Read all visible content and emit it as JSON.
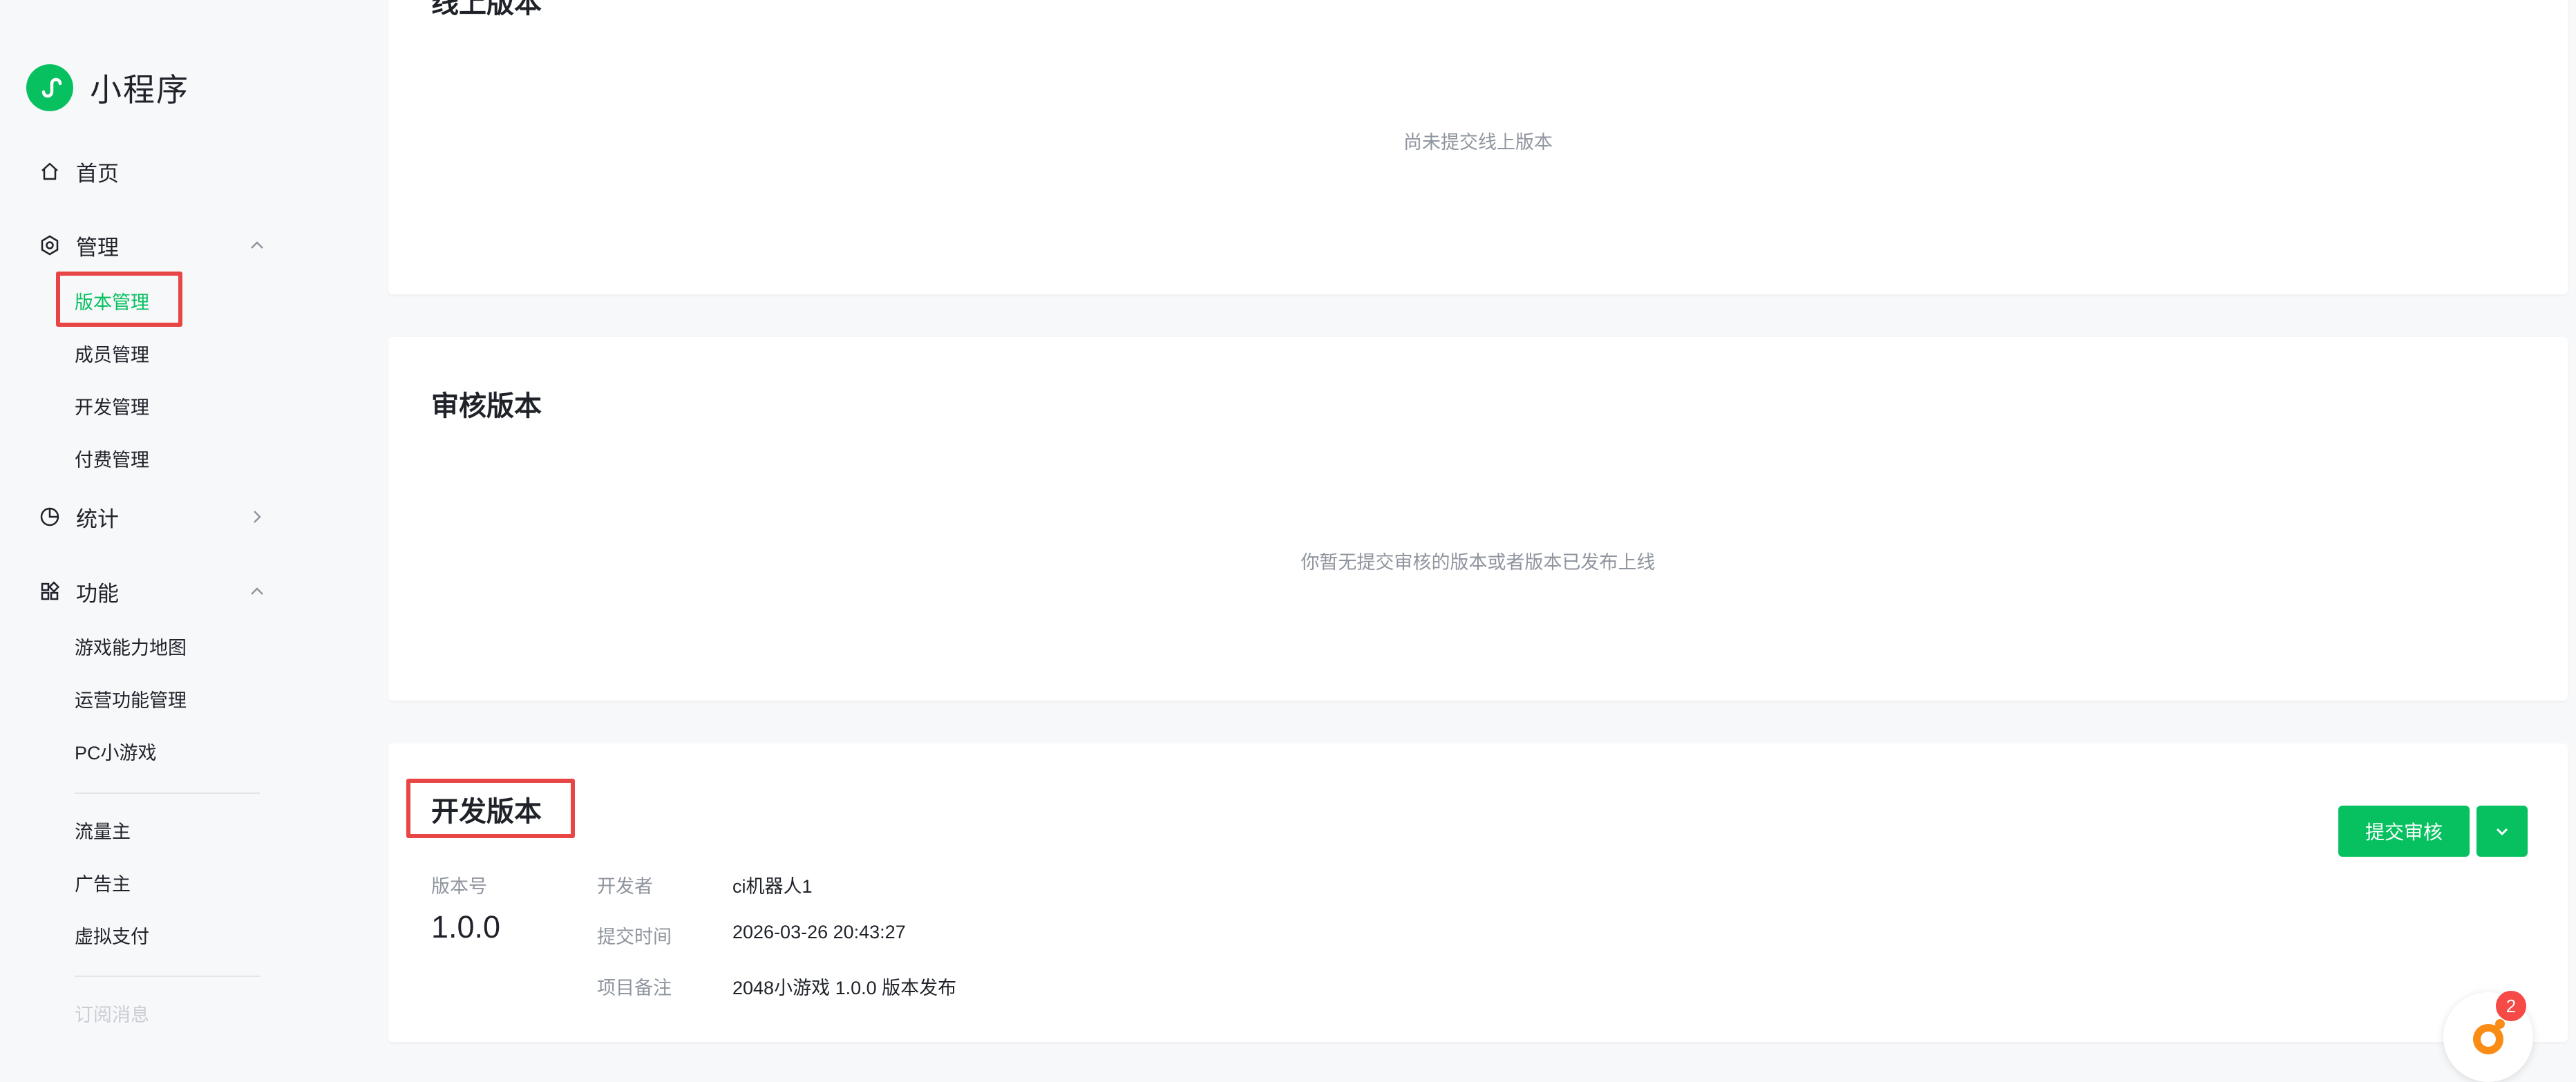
{
  "sidebar": {
    "brand": "小程序",
    "home": "首页",
    "manage": {
      "label": "管理",
      "items": [
        "版本管理",
        "成员管理",
        "开发管理",
        "付费管理"
      ]
    },
    "stats": "统计",
    "features": {
      "label": "功能",
      "items": [
        "游戏能力地图",
        "运营功能管理",
        "PC小游戏"
      ]
    },
    "extra_group": [
      "流量主",
      "广告主",
      "虚拟支付"
    ],
    "last_item": "订阅消息"
  },
  "online": {
    "title": "线上版本",
    "empty": "尚未提交线上版本"
  },
  "review": {
    "title": "审核版本",
    "empty": "你暂无提交审核的版本或者版本已发布上线"
  },
  "dev": {
    "title": "开发版本",
    "version_label": "版本号",
    "version": "1.0.0",
    "developer_label": "开发者",
    "developer": "ci机器人1",
    "time_label": "提交时间",
    "time": "2026-03-26 20:43:27",
    "note_label": "项目备注",
    "note": "2048小游戏 1.0.0 版本发布",
    "submit_button": "提交审核"
  },
  "assistant": {
    "badge": "2"
  },
  "colors": {
    "brand_green": "#07c160",
    "highlight_red": "#e84545",
    "muted_text": "#8f959e"
  }
}
